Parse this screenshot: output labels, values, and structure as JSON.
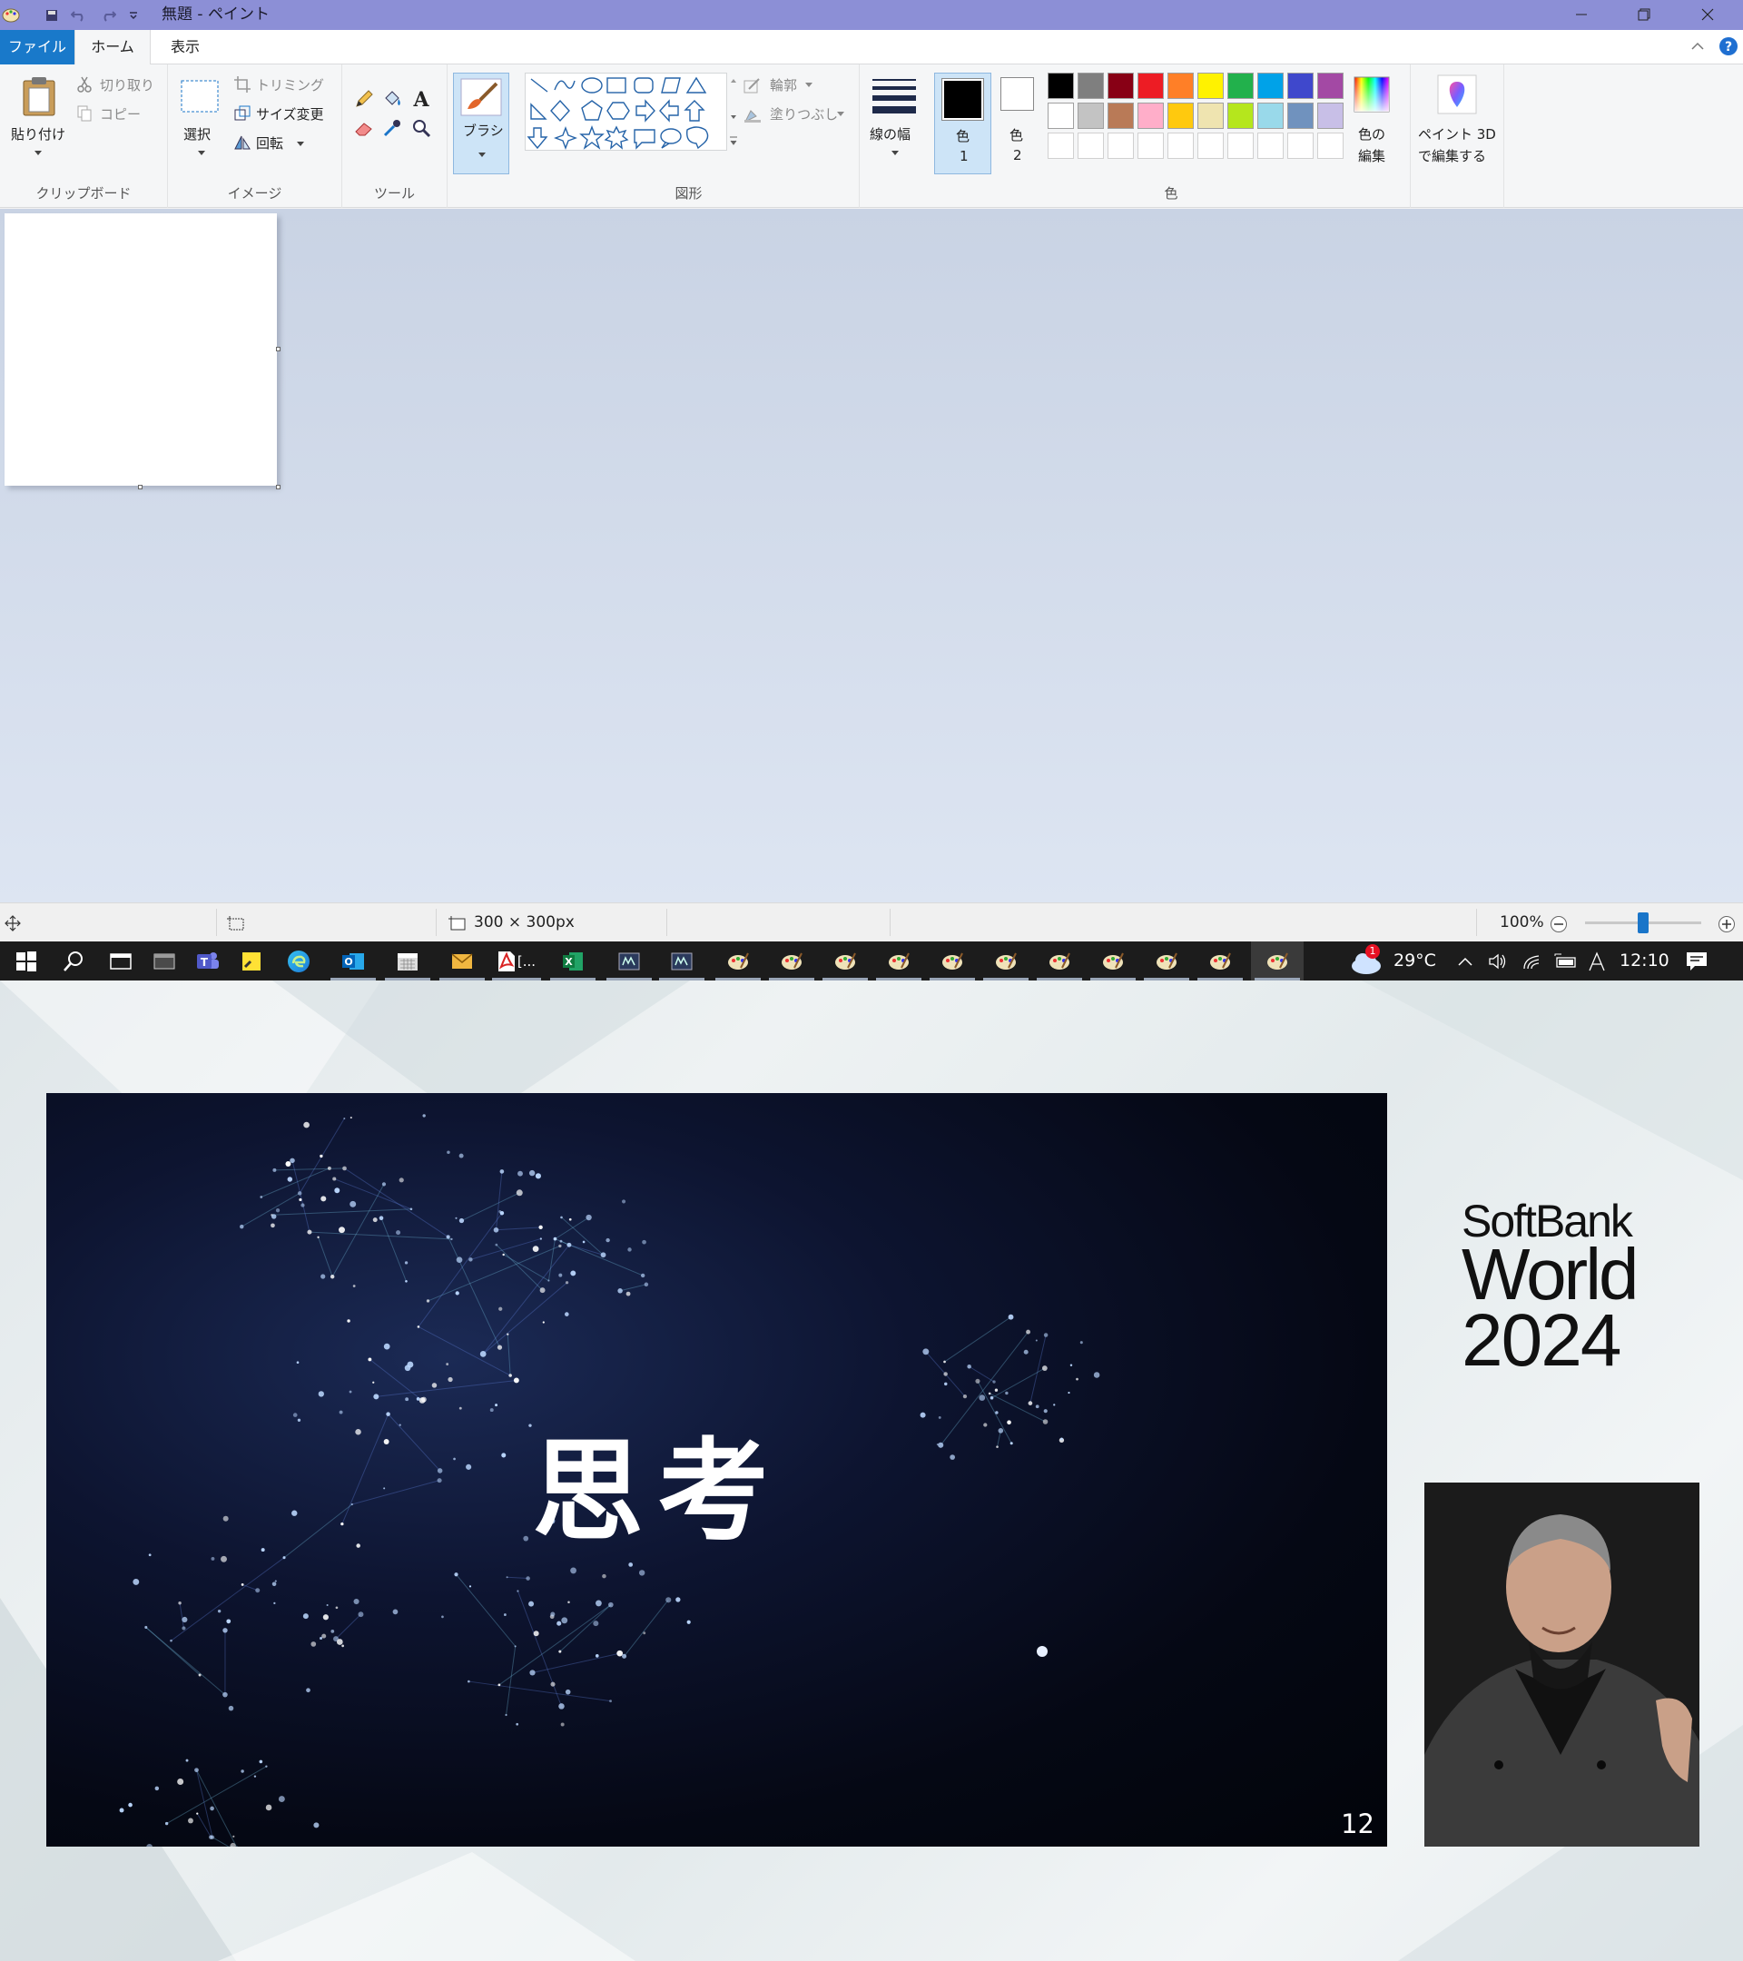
{
  "window": {
    "title": "無題 - ペイント"
  },
  "tabs": [
    "ファイル",
    "ホーム",
    "表示"
  ],
  "ribbon": {
    "clipboard": {
      "group": "クリップボード",
      "paste": "貼り付け",
      "cut": "切り取り",
      "copy": "コピー"
    },
    "image": {
      "group": "イメージ",
      "select": "選択",
      "crop": "トリミング",
      "resize": "サイズ変更",
      "rotate": "回転"
    },
    "tools": {
      "group": "ツール"
    },
    "brush": {
      "label": "ブラシ"
    },
    "shapes": {
      "group": "図形",
      "outline": "輪郭",
      "fill": "塗りつぶし"
    },
    "size": {
      "label": "線の幅"
    },
    "colors": {
      "group": "色",
      "color1_a": "色",
      "color1_b": "1",
      "color2_a": "色",
      "color2_b": "2",
      "edit_a": "色の",
      "edit_b": "編集",
      "row1": [
        "#000000",
        "#7f7f7f",
        "#880015",
        "#ed1c24",
        "#ff7f27",
        "#fff200",
        "#22b14c",
        "#00a2e8",
        "#3f48cc",
        "#a349a4"
      ],
      "row2": [
        "#ffffff",
        "#c3c3c3",
        "#b97a57",
        "#ffaec9",
        "#ffc90e",
        "#efe4b0",
        "#b5e61d",
        "#99d9ea",
        "#7092be",
        "#c8bfe7"
      ]
    },
    "paint3d": {
      "line1": "ペイント 3D",
      "line2": "で編集する"
    }
  },
  "status": {
    "dimensions": "300 × 300px",
    "zoom": "100%",
    "zoom_level_fraction": 0.5
  },
  "taskbar": {
    "weather_badge": "1",
    "temperature": "29°C",
    "clock": "12:10",
    "pdf_label": "[..."
  },
  "presentation": {
    "slide_title": "思考",
    "slide_number": "12",
    "brand_line1": "SoftBank",
    "brand_line2": "World",
    "brand_line3": "2024"
  }
}
